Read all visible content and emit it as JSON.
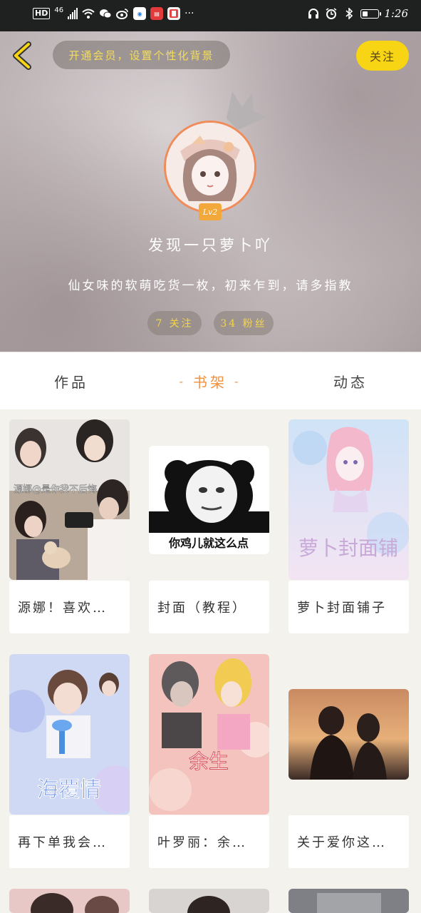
{
  "status_bar": {
    "hd": "HD",
    "network": "46",
    "time": "1:26",
    "more": "···"
  },
  "header": {
    "vip_prompt": "开通会员，设置个性化背景",
    "follow_label": "关注",
    "level": "Lv2",
    "username": "发现一只萝卜吖",
    "bio": "仙女味的软萌吃货一枚，初来乍到，请多指教",
    "following_label": "7 关注",
    "fans_label": "34 粉丝"
  },
  "tabs": {
    "works": "作品",
    "shelf": "书架",
    "feed": "动态",
    "active": "shelf"
  },
  "books": [
    {
      "title": "源娜！喜欢…",
      "cover_text": "源娜@是你我不后悔"
    },
    {
      "title": "封面（教程）",
      "cover_text": "你鸡儿就这么点"
    },
    {
      "title": "萝卜封面铺子",
      "cover_text": "萝卜封面铺"
    },
    {
      "title": "再下单我会…",
      "cover_text": "海覆情"
    },
    {
      "title": "叶罗丽：余…",
      "cover_text": "余生"
    },
    {
      "title": "关于爱你这…",
      "cover_text": ""
    }
  ],
  "colors": {
    "accent": "#ee9244",
    "follow_button": "#f7d414",
    "pill_text": "#f4d54a",
    "level_badge": "#f3a83c"
  }
}
